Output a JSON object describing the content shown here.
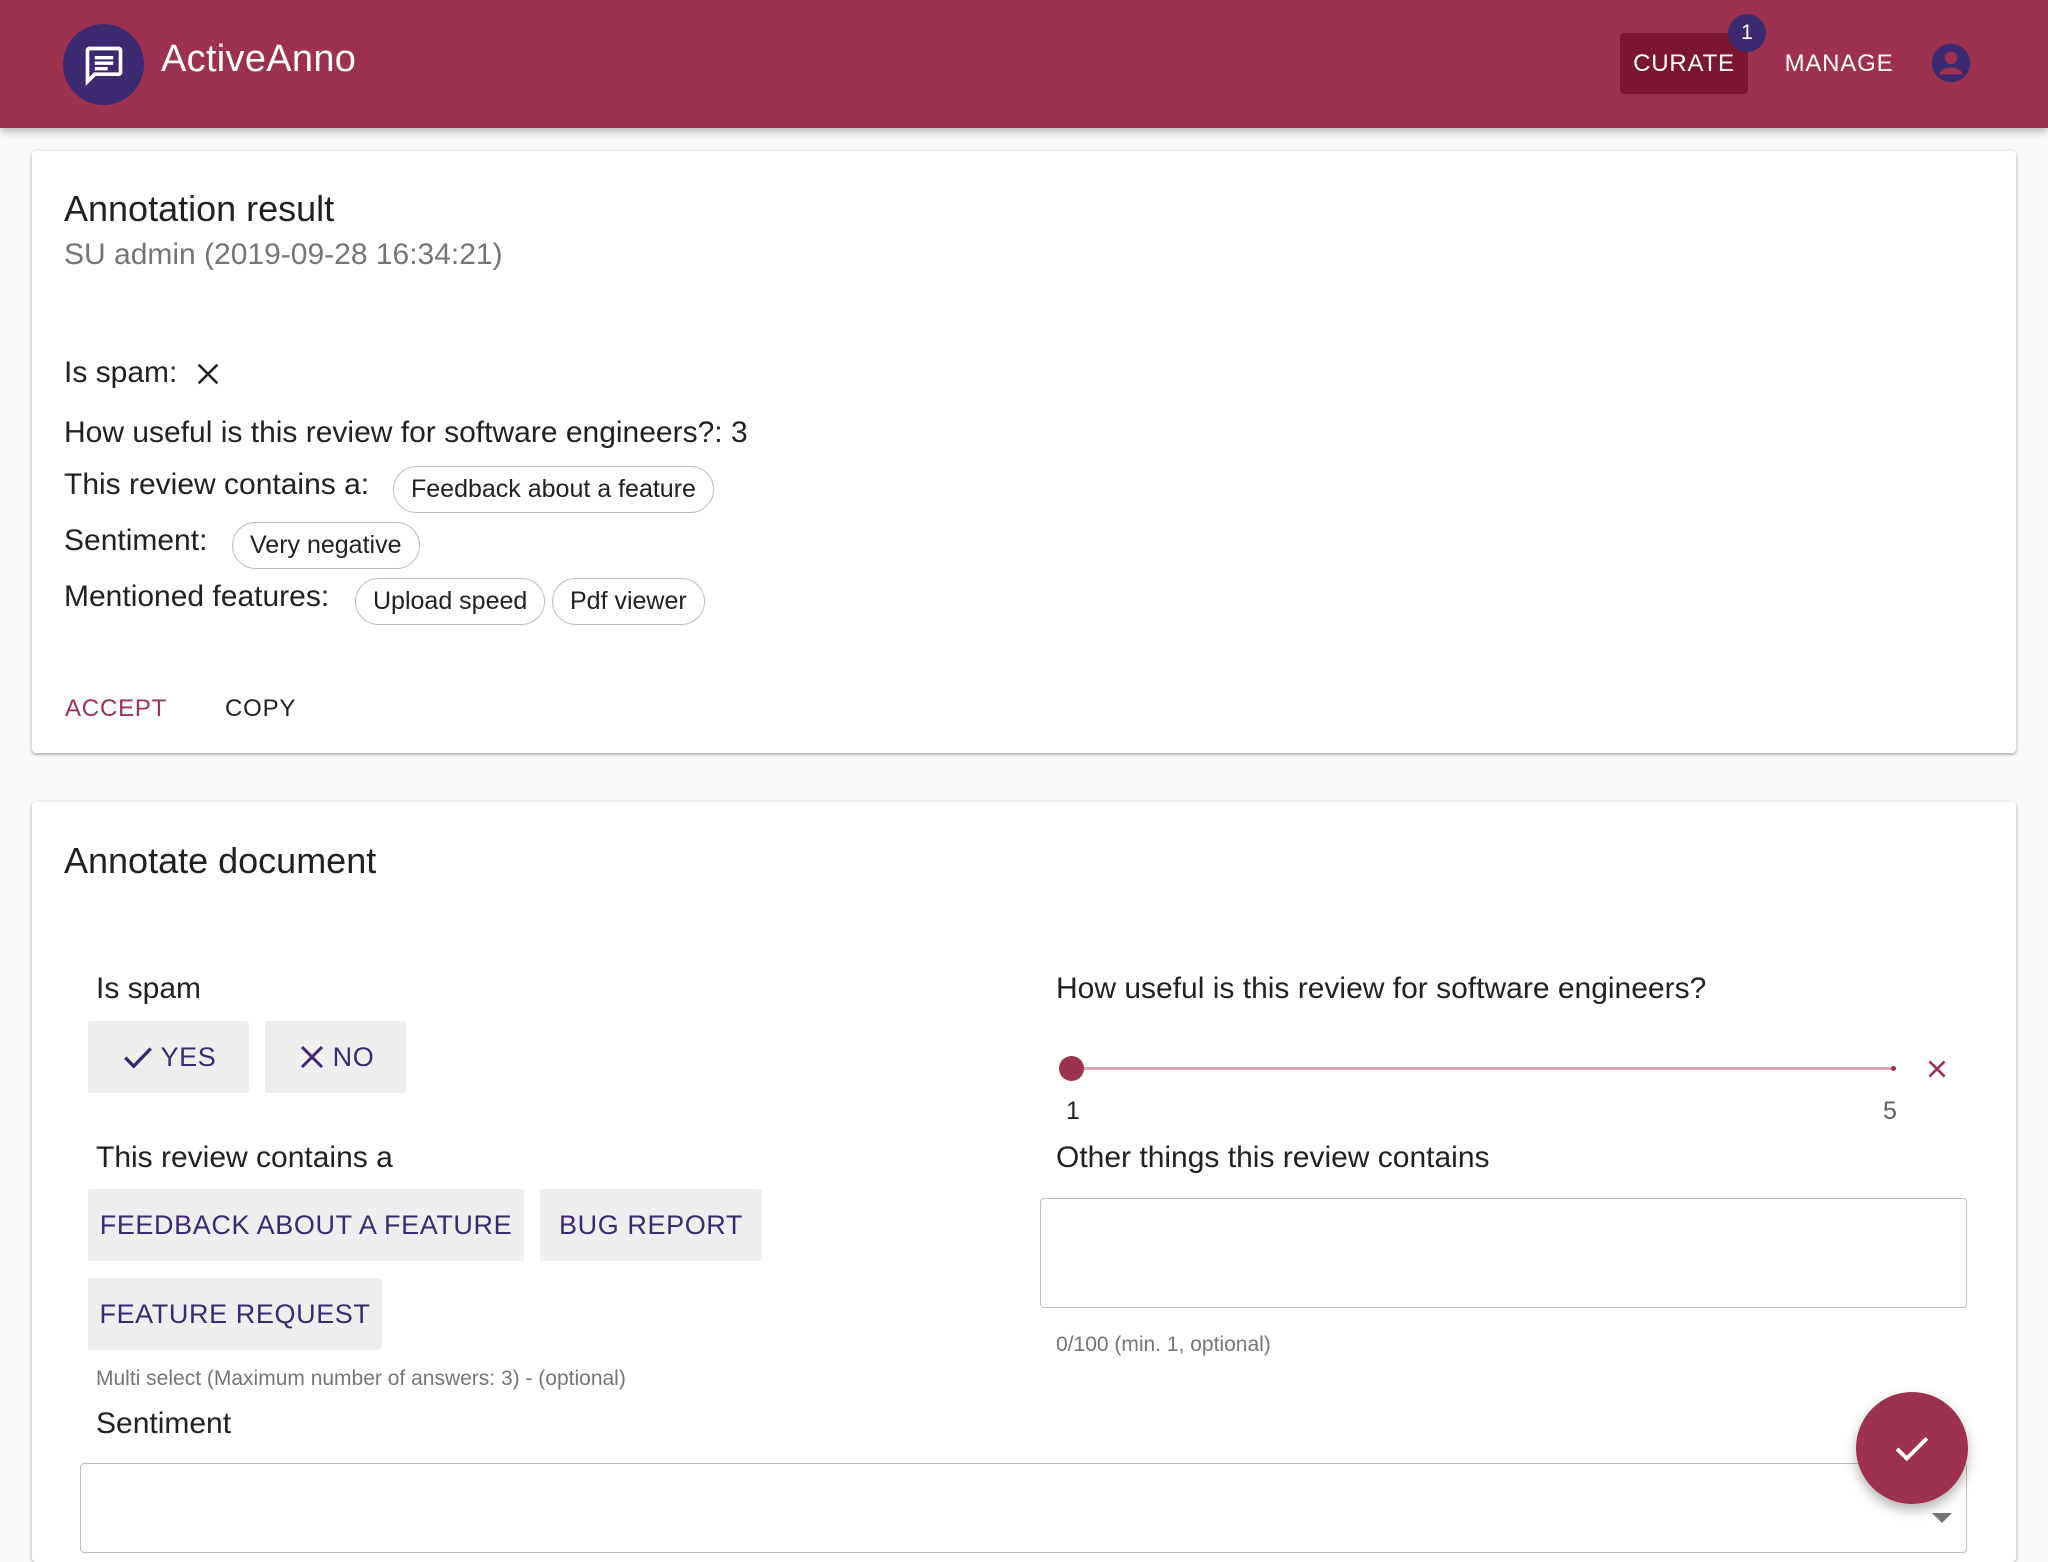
{
  "appbar": {
    "title": "ActiveAnno",
    "logo_icon": "chat-message-icon",
    "nav": {
      "curate_label": "CURATE",
      "curate_badge": "1",
      "manage_label": "MANAGE"
    },
    "account_icon": "account-circle-icon",
    "color": "#9c3150"
  },
  "result_card": {
    "title": "Annotation result",
    "subtitle": "SU admin (2019-09-28 16:34:21)",
    "is_spam_label": "Is spam:",
    "usefulness_text": "How useful is this review for software engineers?: 3",
    "contains_label": "This review contains a:",
    "contains_chips": [
      "Feedback about a feature"
    ],
    "sentiment_label": "Sentiment:",
    "sentiment_chips": [
      "Very negative"
    ],
    "features_label": "Mentioned features:",
    "features_chips": [
      "Upload speed",
      "Pdf viewer"
    ],
    "accept_label": "ACCEPT",
    "copy_label": "COPY"
  },
  "annotate_card": {
    "title": "Annotate document",
    "is_spam": {
      "label": "Is spam",
      "yes_label": "YES",
      "no_label": "NO"
    },
    "usefulness": {
      "label": "How useful is this review for software engineers?",
      "min_label": "1",
      "max_label": "5",
      "value": 1,
      "min": 1,
      "max": 5
    },
    "contains": {
      "label": "This review contains a",
      "options": [
        "FEEDBACK ABOUT A FEATURE",
        "BUG REPORT",
        "FEATURE REQUEST"
      ],
      "helper": "Multi select (Maximum number of answers: 3) - (optional)"
    },
    "other_things": {
      "label": "Other things this review contains",
      "value": "",
      "helper": "0/100 (min. 1, optional)"
    },
    "sentiment": {
      "label": "Sentiment",
      "selected": ""
    }
  },
  "fab_icon": "check-icon",
  "colors": {
    "accent": "#9c3150",
    "primary_dark": "#3b2a70"
  }
}
